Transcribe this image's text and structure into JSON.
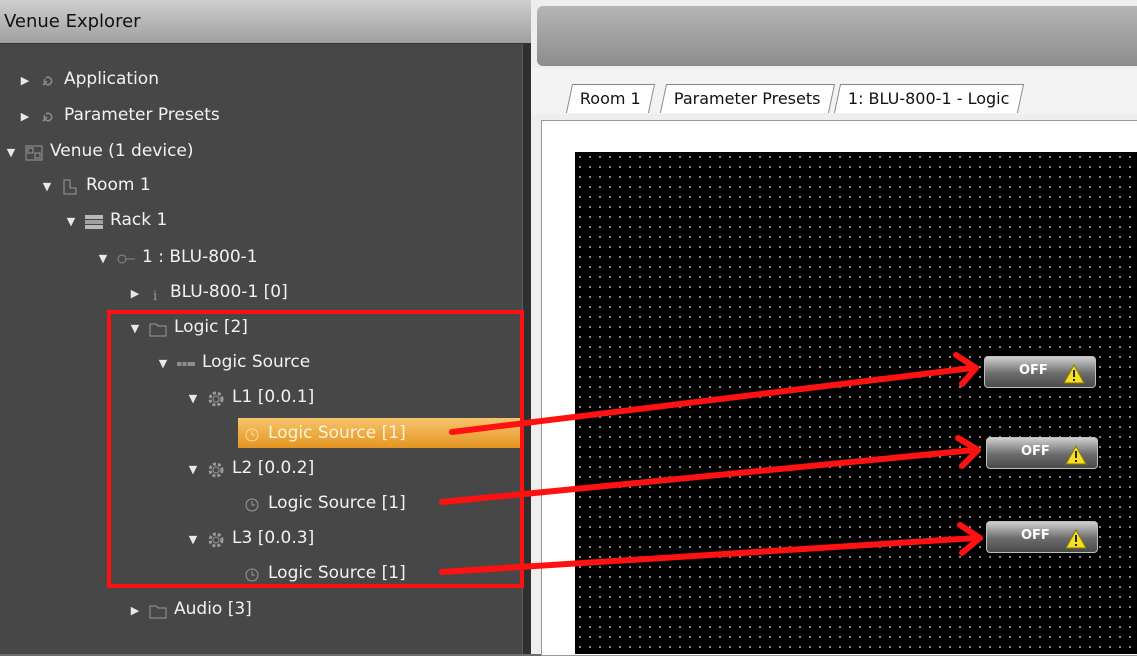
{
  "explorer": {
    "title": "Venue Explorer",
    "tree": [
      {
        "label": "Application"
      },
      {
        "label": "Parameter Presets"
      },
      {
        "label": "Venue (1 device)"
      },
      {
        "label": "Room 1"
      },
      {
        "label": "Rack 1"
      },
      {
        "label": "1 : BLU-800-1"
      },
      {
        "label": "BLU-800-1 [0]"
      },
      {
        "label": "Logic [2]"
      },
      {
        "label": "Logic Source"
      },
      {
        "label": "L1 [0.0.1]"
      },
      {
        "label": "Logic Source [1]"
      },
      {
        "label": "L2 [0.0.2]"
      },
      {
        "label": "Logic Source [1]"
      },
      {
        "label": "L3 [0.0.3]"
      },
      {
        "label": "Logic Source [1]"
      },
      {
        "label": "Audio [3]"
      }
    ]
  },
  "workspace": {
    "tabs": [
      {
        "label": "Room 1"
      },
      {
        "label": "Parameter Presets"
      },
      {
        "label": "1: BLU-800-1 - Logic"
      }
    ],
    "controls": [
      {
        "label": "OFF"
      },
      {
        "label": "OFF"
      },
      {
        "label": "OFF"
      }
    ]
  },
  "colors": {
    "selection": "#e8a030",
    "annotation": "#ff1111",
    "warning": "#f4e020"
  }
}
